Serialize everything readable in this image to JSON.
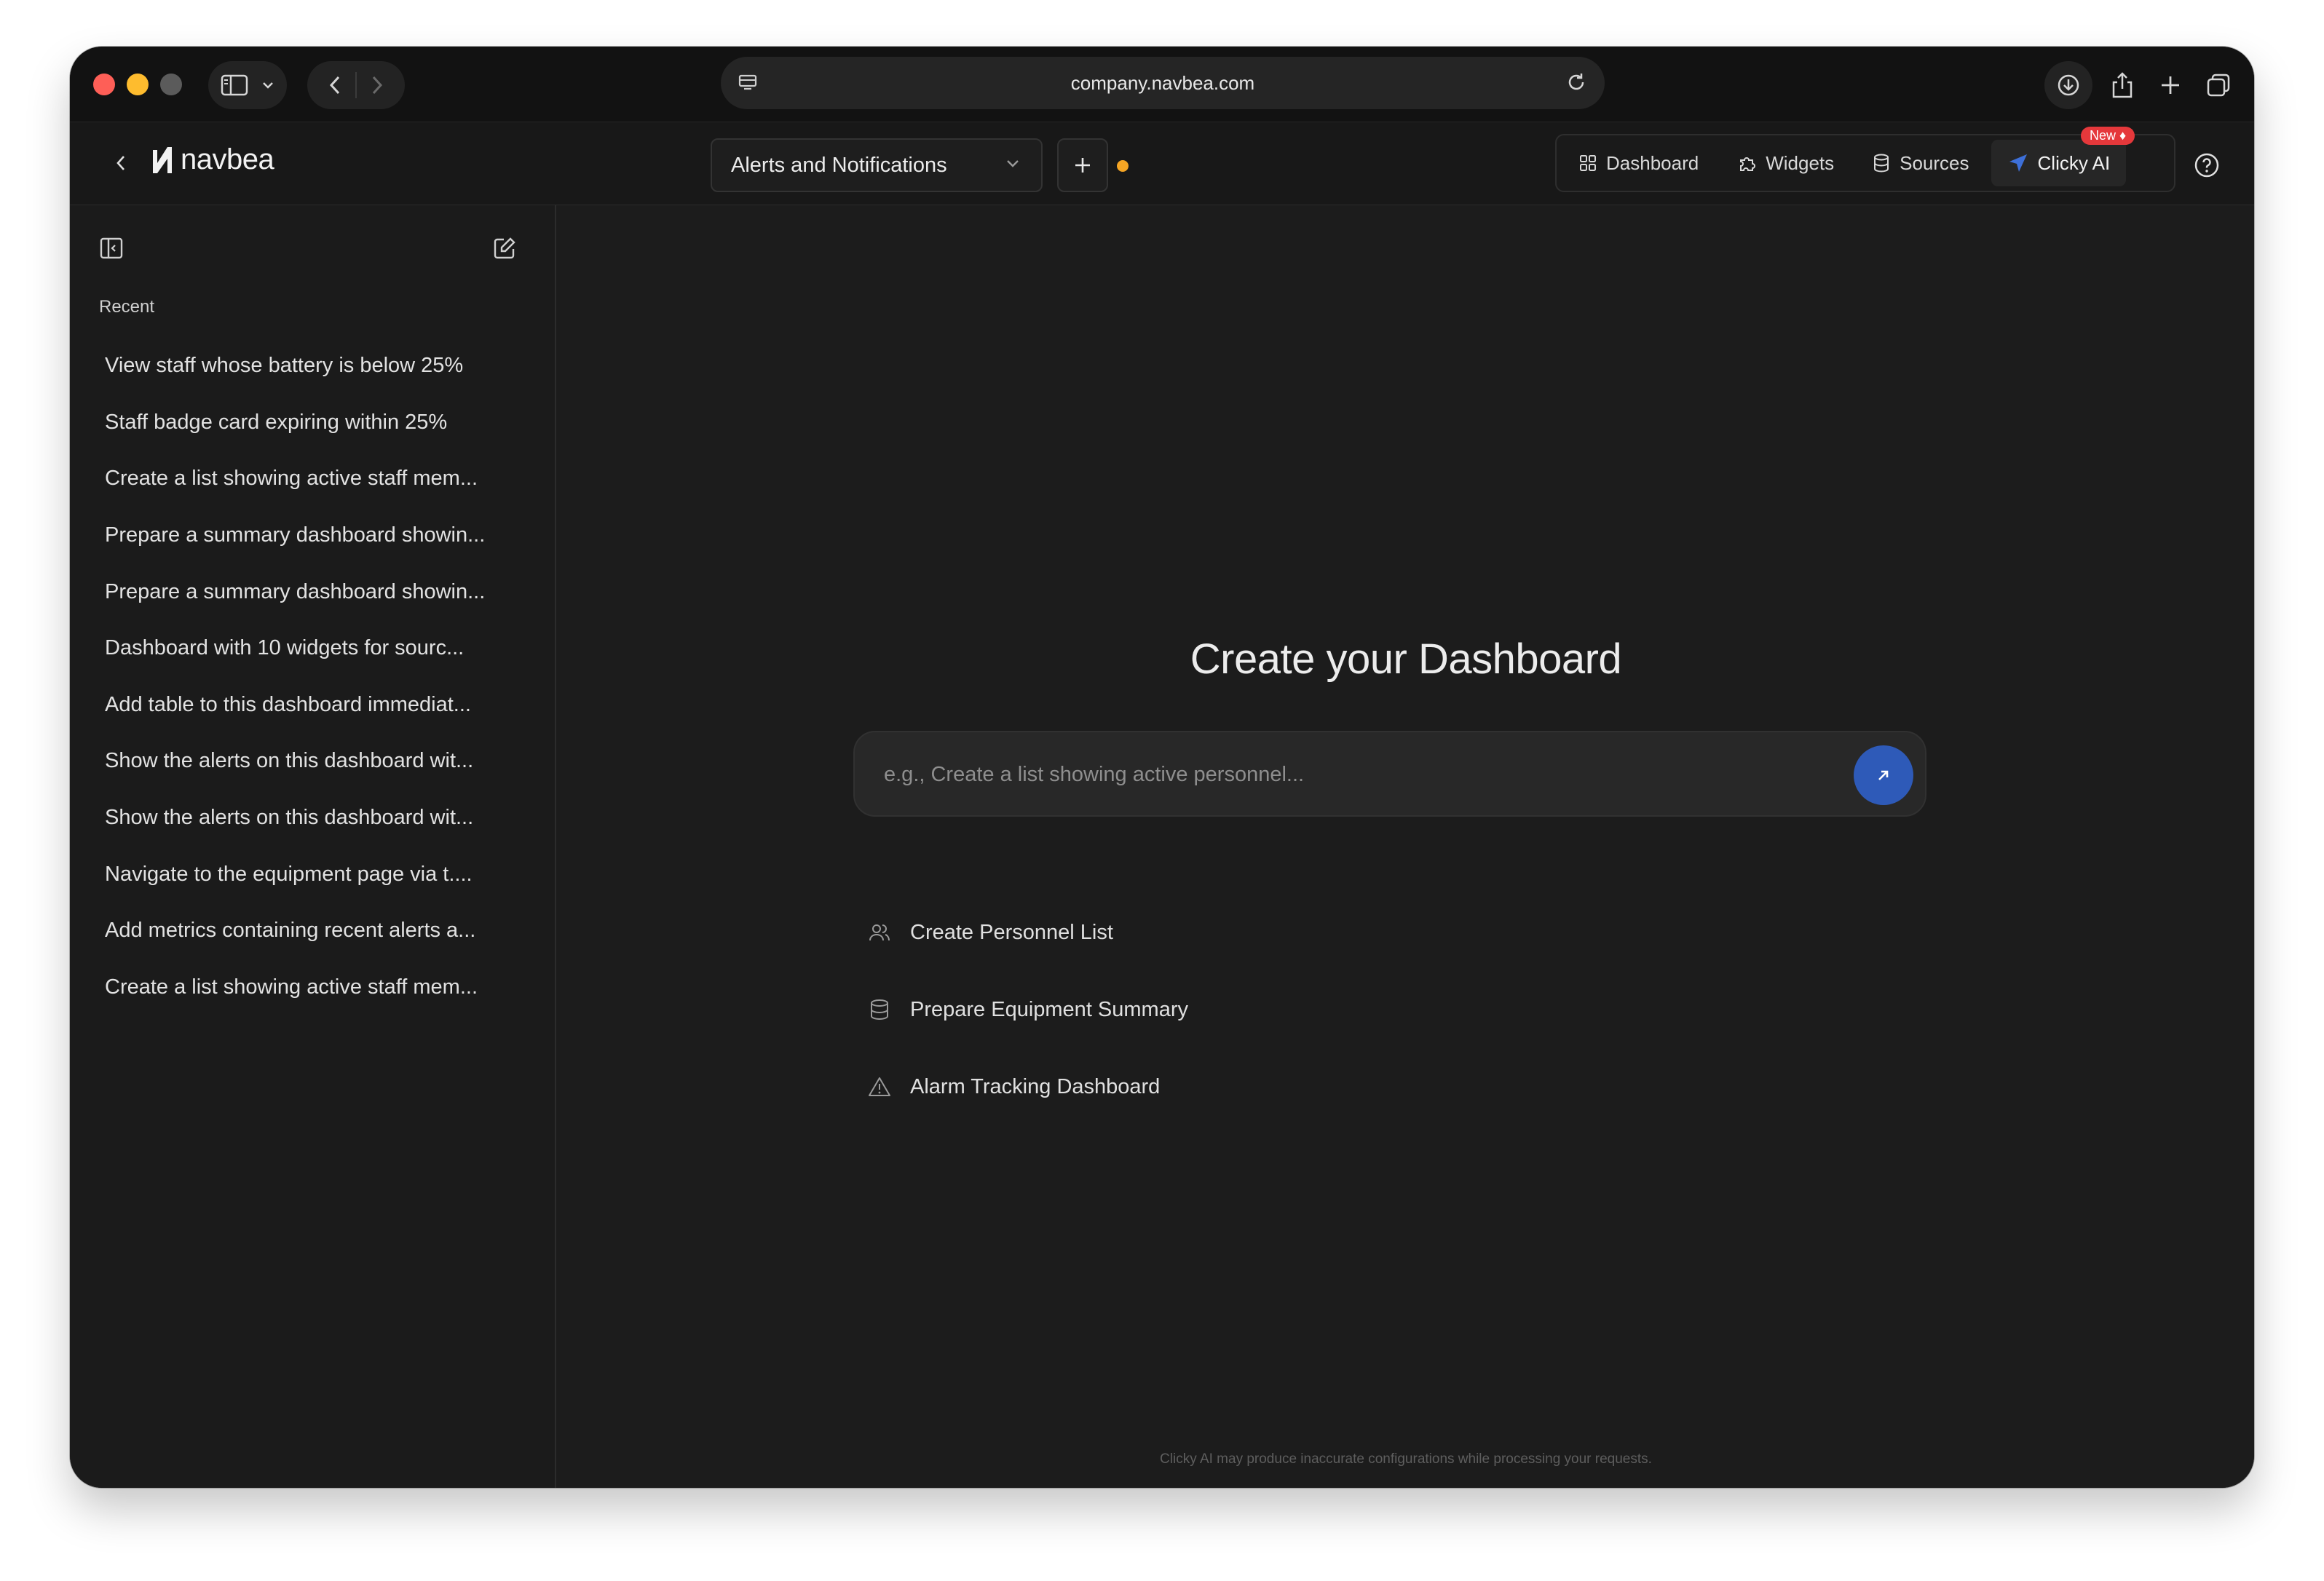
{
  "browser": {
    "url": "company.navbea.com"
  },
  "app": {
    "logo_text": "navbea",
    "dashboard_select": "Alerts and Notifications",
    "nav_tabs": [
      {
        "label": "Dashboard",
        "icon": "grid-icon"
      },
      {
        "label": "Widgets",
        "icon": "puzzle-icon"
      },
      {
        "label": "Sources",
        "icon": "database-icon"
      },
      {
        "label": "Clicky AI",
        "icon": "send-arrow-icon",
        "badge": "New ♦"
      }
    ],
    "active_tab": "Clicky AI",
    "status_dot_color": "#f5a524"
  },
  "sidebar": {
    "recent_label": "Recent",
    "items": [
      "View staff whose battery is below 25%",
      "Staff badge card expiring within 25%",
      "Create a list showing active staff mem...",
      "Prepare a summary dashboard showin...",
      "Prepare a summary dashboard showin...",
      "Dashboard with 10 widgets for sourc...",
      "Add table to this dashboard immediat...",
      "Show the alerts on this dashboard wit...",
      "Show the alerts on this dashboard wit...",
      "Navigate to the equipment page via t....",
      "Add metrics containing recent alerts a...",
      "Create a list showing active staff mem..."
    ]
  },
  "main": {
    "title": "Create your Dashboard",
    "prompt_placeholder": "e.g., Create a list showing active personnel...",
    "suggestions": [
      {
        "label": "Create Personnel List",
        "icon": "users-icon"
      },
      {
        "label": "Prepare Equipment Summary",
        "icon": "database-icon"
      },
      {
        "label": "Alarm Tracking Dashboard",
        "icon": "warning-icon"
      }
    ],
    "disclaimer": "Clicky AI may produce inaccurate configurations while processing your requests."
  },
  "colors": {
    "accent_blue": "#2e5ab8",
    "badge_red": "#e5383b",
    "background": "#1c1c1c"
  }
}
